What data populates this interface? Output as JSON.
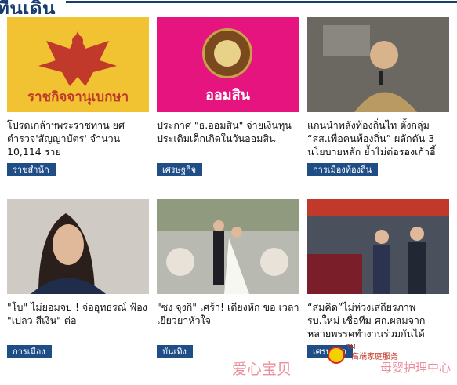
{
  "section": {
    "title": "ที่นเดิน"
  },
  "cards": [
    {
      "image_caption": "ราชกิจจานุเบกษา",
      "headline": "โปรดเกล้าฯพระราชทาน ยศตำรวจ'สัญญาบัตร' จำนวน 10,114 ราย",
      "category": "ราชสำนัก"
    },
    {
      "image_caption": "ออมสิน",
      "headline": "ประกาศ \"ธ.ออมสิน\" จ่ายเงินทุน ประเดิมเด็กเกิดในวันออมสิน",
      "category": "เศรษฐกิจ"
    },
    {
      "image_caption": "",
      "headline": "แกนนำพลังท้องถิ่นไท ตั้งกลุ่ม “สส.เพื่อคนท้องถิ่น” ผลักดัน 3 นโยบายหลัก ย้ำไม่ต่อรองเก้าอี้",
      "category": "การเมืองท้องถิ่น"
    },
    {
      "image_caption": "",
      "headline": "\"โบ\" ไม่ยอมจบ ! จ่ออุทธรณ์ ฟ้อง \"เปลว สีเงิน\" ต่อ",
      "category": "การเมือง"
    },
    {
      "image_caption": "",
      "headline": "\"ซง จุงกิ\" เศร้า! เตียงหัก ขอ เวลาเยียวยาหัวใจ",
      "category": "บันเทิง"
    },
    {
      "image_caption": "",
      "headline": "“สมคิด”ไม่ห่วงเสถียรภาพ รบ.ใหม่ เชื่อทีม ศก.ผสมจาก หลายพรรคทำงานร่วมกันได้",
      "category": "เศรษฐกิจ"
    }
  ],
  "watermark": {
    "left_text": "爱心宝贝",
    "center_text": "高端家庭服务",
    "tm": "TM",
    "right_text": "母婴护理中心"
  }
}
